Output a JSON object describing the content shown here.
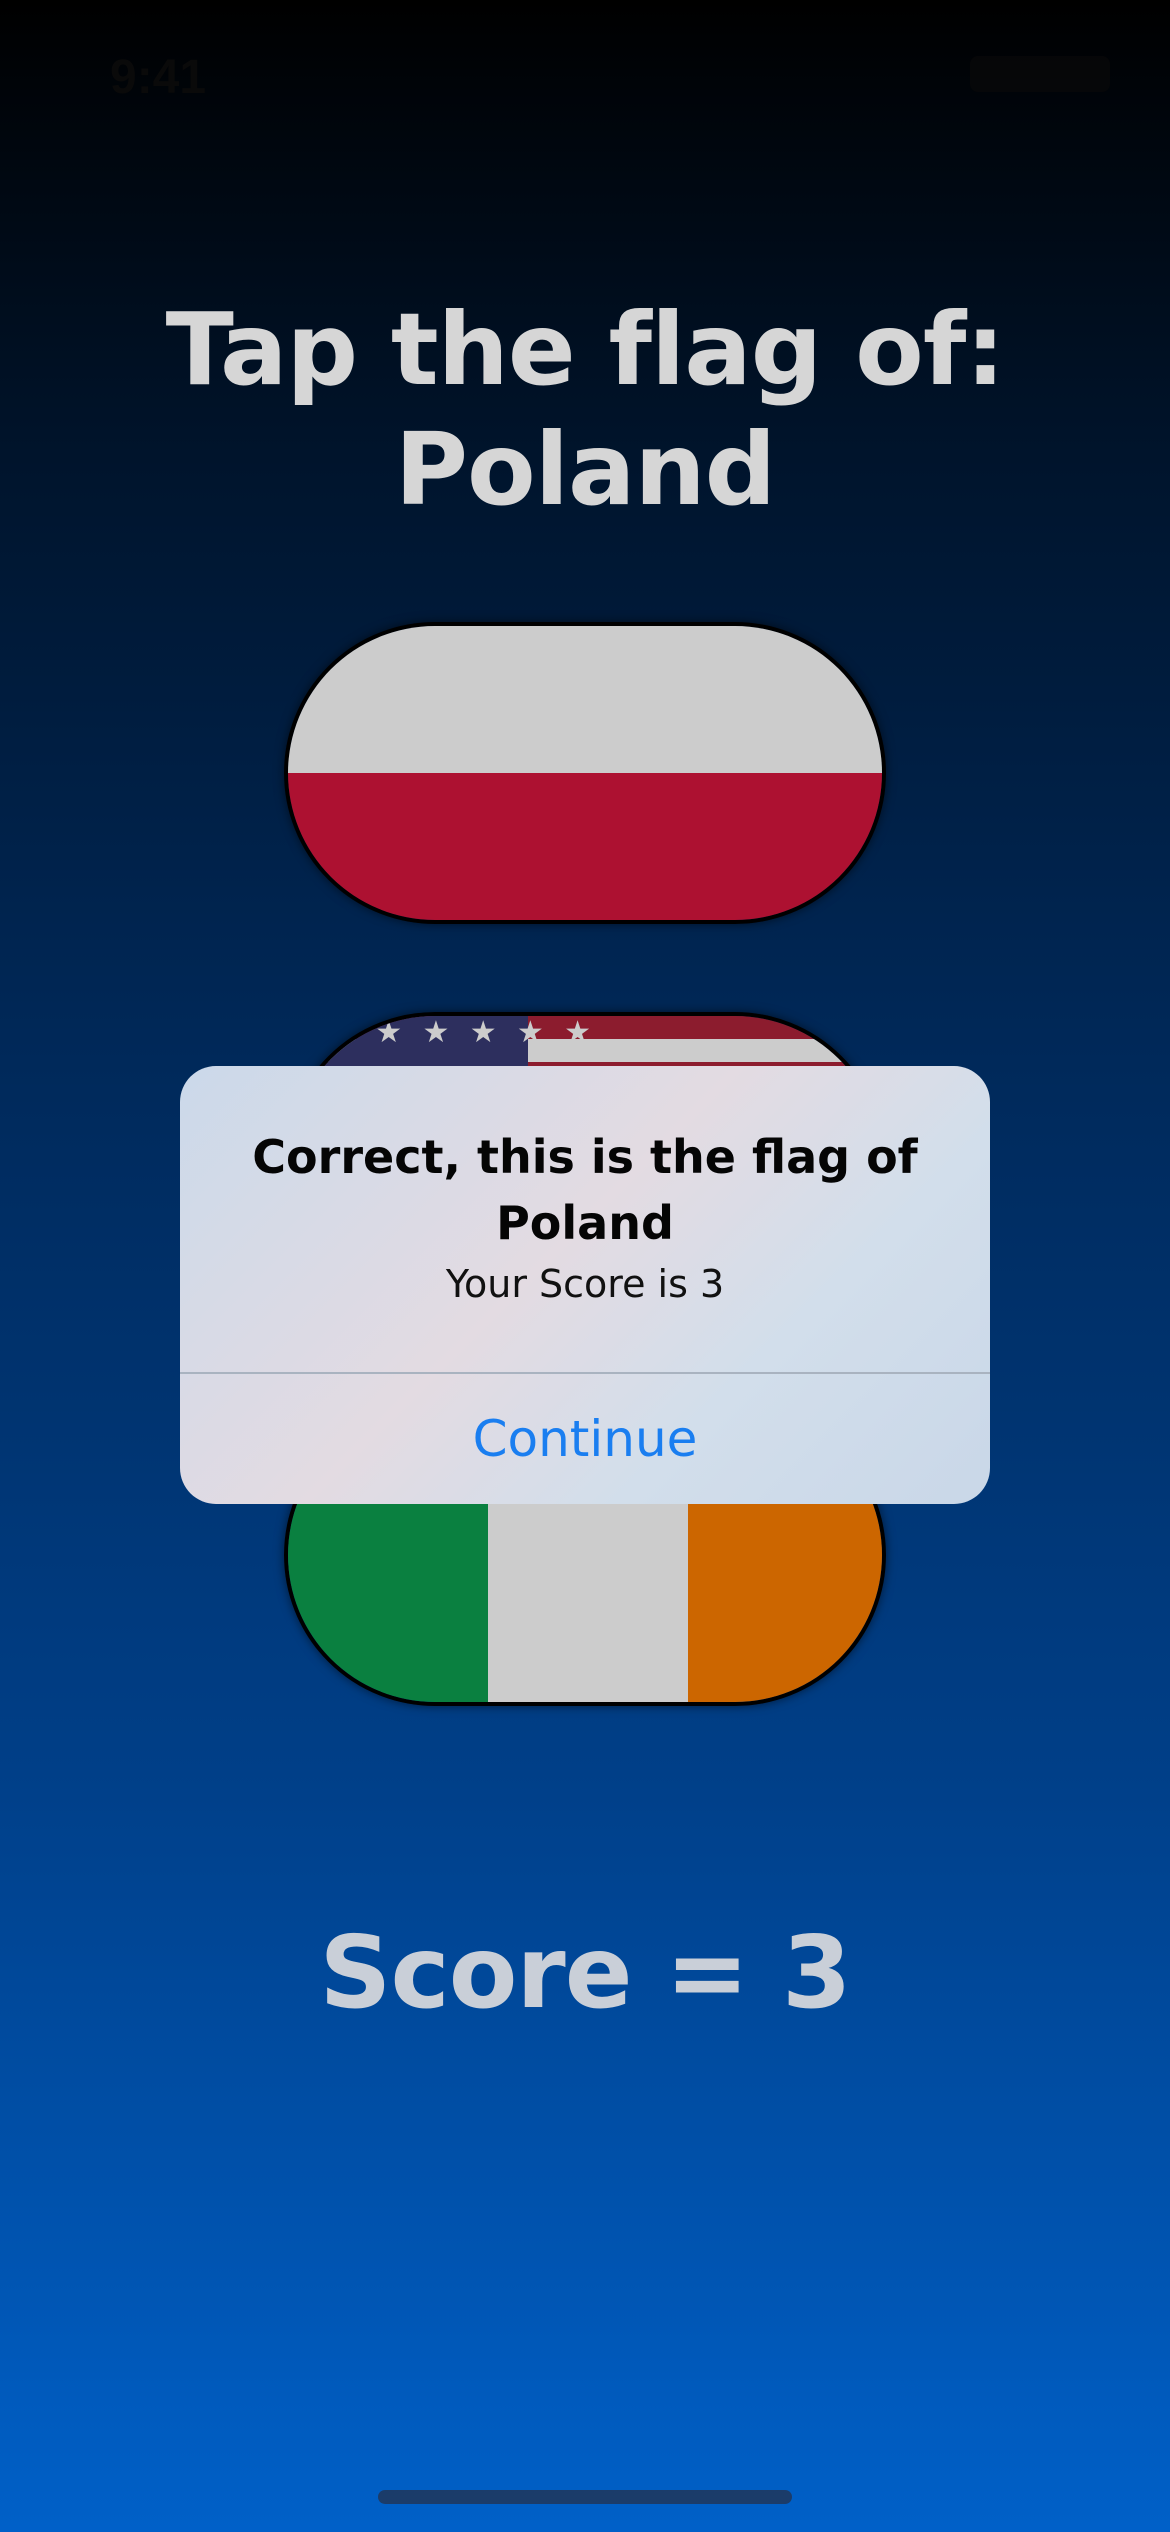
{
  "status_bar": {
    "time": "9:41"
  },
  "prompt": {
    "line1": "Tap the flag of:",
    "line2": "Poland"
  },
  "flags": [
    {
      "country": "Poland",
      "icon": "poland-flag"
    },
    {
      "country": "United States",
      "icon": "usa-flag",
      "stars": "★ ★ ★ ★ ★ ★"
    },
    {
      "country": "Ireland",
      "icon": "ireland-flag"
    }
  ],
  "alert": {
    "title": "Correct, this is the flag of Poland",
    "message": "Your Score is 3",
    "button_label": "Continue"
  },
  "score": {
    "text": "Score = 3"
  },
  "colors": {
    "accent": "#1a7ef0",
    "poland_red": "#ad1131",
    "ireland_green": "#0a8040",
    "ireland_orange": "#cc6600",
    "usa_blue": "#2d2f5e",
    "usa_red": "#8c1c2e"
  }
}
